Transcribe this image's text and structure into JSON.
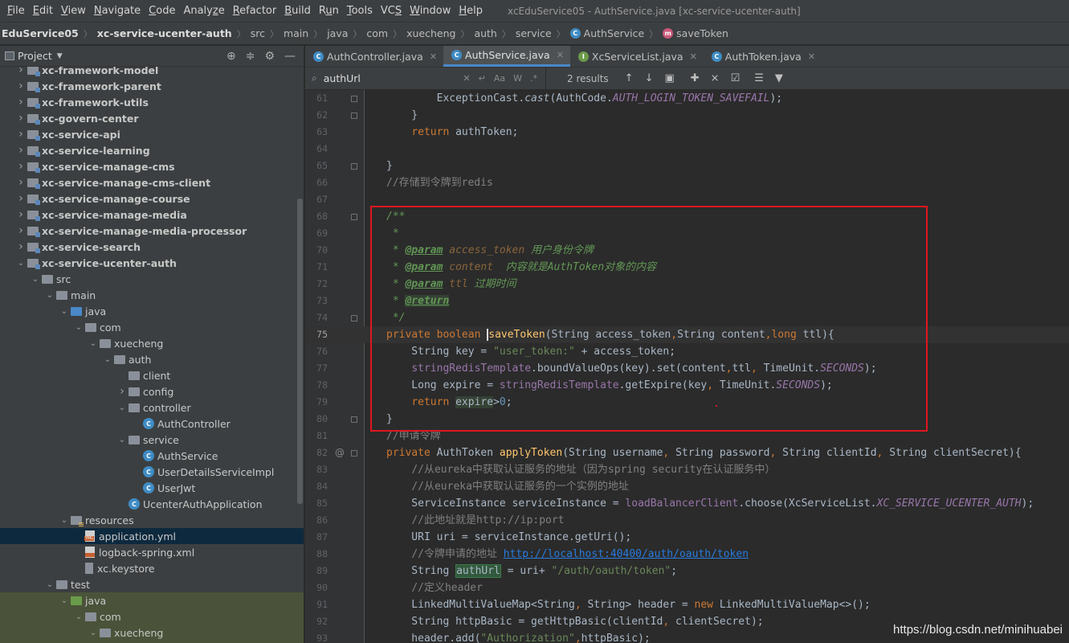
{
  "menu": {
    "items": [
      "File",
      "Edit",
      "View",
      "Navigate",
      "Code",
      "Analyze",
      "Refactor",
      "Build",
      "Run",
      "Tools",
      "VCS",
      "Window",
      "Help"
    ],
    "mnemonics": [
      "F",
      "E",
      "V",
      "N",
      "C",
      "z",
      "R",
      "B",
      "u",
      "T",
      "S",
      "W",
      "H"
    ],
    "window_title": "xcEduService05 - AuthService.java [xc-service-ucenter-auth]"
  },
  "breadcrumb": {
    "project": "EduService05",
    "module": "xc-service-ucenter-auth",
    "parts": [
      "src",
      "main",
      "java",
      "com",
      "xuecheng",
      "auth",
      "service"
    ],
    "class_name": "AuthService",
    "method_name": "saveToken",
    "class_icon_letter": "C",
    "method_icon_letter": "m"
  },
  "project_panel": {
    "title": "Project",
    "tree": [
      {
        "label": "xc-framework-model",
        "depth": 0,
        "arrow": "right",
        "icon": "module"
      },
      {
        "label": "xc-framework-parent",
        "depth": 0,
        "arrow": "right",
        "icon": "module"
      },
      {
        "label": "xc-framework-utils",
        "depth": 0,
        "arrow": "right",
        "icon": "module"
      },
      {
        "label": "xc-govern-center",
        "depth": 0,
        "arrow": "right",
        "icon": "module"
      },
      {
        "label": "xc-service-api",
        "depth": 0,
        "arrow": "right",
        "icon": "module"
      },
      {
        "label": "xc-service-learning",
        "depth": 0,
        "arrow": "right",
        "icon": "module"
      },
      {
        "label": "xc-service-manage-cms",
        "depth": 0,
        "arrow": "right",
        "icon": "module"
      },
      {
        "label": "xc-service-manage-cms-client",
        "depth": 0,
        "arrow": "right",
        "icon": "module"
      },
      {
        "label": "xc-service-manage-course",
        "depth": 0,
        "arrow": "right",
        "icon": "module"
      },
      {
        "label": "xc-service-manage-media",
        "depth": 0,
        "arrow": "right",
        "icon": "module"
      },
      {
        "label": "xc-service-manage-media-processor",
        "depth": 0,
        "arrow": "right",
        "icon": "module"
      },
      {
        "label": "xc-service-search",
        "depth": 0,
        "arrow": "right",
        "icon": "module"
      },
      {
        "label": "xc-service-ucenter-auth",
        "depth": 0,
        "arrow": "down",
        "icon": "module"
      },
      {
        "label": "src",
        "depth": 1,
        "arrow": "down",
        "icon": "folder"
      },
      {
        "label": "main",
        "depth": 2,
        "arrow": "down",
        "icon": "folder"
      },
      {
        "label": "java",
        "depth": 3,
        "arrow": "down",
        "icon": "blue"
      },
      {
        "label": "com",
        "depth": 4,
        "arrow": "down",
        "icon": "folder"
      },
      {
        "label": "xuecheng",
        "depth": 5,
        "arrow": "down",
        "icon": "folder"
      },
      {
        "label": "auth",
        "depth": 6,
        "arrow": "down",
        "icon": "folder"
      },
      {
        "label": "client",
        "depth": 7,
        "arrow": "none",
        "icon": "folder"
      },
      {
        "label": "config",
        "depth": 7,
        "arrow": "right",
        "icon": "folder"
      },
      {
        "label": "controller",
        "depth": 7,
        "arrow": "down",
        "icon": "folder"
      },
      {
        "label": "AuthController",
        "depth": 8,
        "arrow": "none",
        "icon": "class"
      },
      {
        "label": "service",
        "depth": 7,
        "arrow": "down",
        "icon": "folder"
      },
      {
        "label": "AuthService",
        "depth": 8,
        "arrow": "none",
        "icon": "class"
      },
      {
        "label": "UserDetailsServiceImpl",
        "depth": 8,
        "arrow": "none",
        "icon": "class"
      },
      {
        "label": "UserJwt",
        "depth": 8,
        "arrow": "none",
        "icon": "class"
      },
      {
        "label": "UcenterAuthApplication",
        "depth": 7,
        "arrow": "none",
        "icon": "class"
      },
      {
        "label": "resources",
        "depth": 3,
        "arrow": "down",
        "icon": "res"
      },
      {
        "label": "application.yml",
        "depth": 4,
        "arrow": "none",
        "icon": "yml",
        "selected": true
      },
      {
        "label": "logback-spring.xml",
        "depth": 4,
        "arrow": "none",
        "icon": "xml"
      },
      {
        "label": "xc.keystore",
        "depth": 4,
        "arrow": "none",
        "icon": "key"
      },
      {
        "label": "test",
        "depth": 2,
        "arrow": "down",
        "icon": "folder"
      },
      {
        "label": "java",
        "depth": 3,
        "arrow": "down",
        "icon": "green",
        "test": true
      },
      {
        "label": "com",
        "depth": 4,
        "arrow": "down",
        "icon": "folder",
        "test": true
      },
      {
        "label": "xuecheng",
        "depth": 5,
        "arrow": "down",
        "icon": "folder",
        "test": true
      },
      {
        "label": "",
        "depth": 6,
        "arrow": "right",
        "icon": "folder",
        "test": true
      }
    ]
  },
  "tabs": [
    {
      "label": "AuthController.java",
      "active": false,
      "icon": "class"
    },
    {
      "label": "AuthService.java",
      "active": true,
      "icon": "class"
    },
    {
      "label": "XcServiceList.java",
      "active": false,
      "icon": "interface"
    },
    {
      "label": "AuthToken.java",
      "active": false,
      "icon": "class"
    }
  ],
  "search": {
    "value": "authUrl",
    "results": "2 results",
    "option_case": "Aa",
    "option_words": "W",
    "option_regex": ".*"
  },
  "editor": {
    "lines": [
      {
        "n": "61",
        "mark": "",
        "fold": true,
        "cur": false,
        "segs": [
          [
            "        ",
            ""
          ],
          [
            "ExceptionCast.",
            ""
          ],
          [
            "cast",
            "it"
          ],
          [
            "(AuthCode.",
            ""
          ],
          [
            "AUTH_LOGIN_TOKEN_SAVEFAIL",
            "cst"
          ],
          [
            ");",
            ""
          ]
        ]
      },
      {
        "n": "62",
        "mark": "",
        "fold": true,
        "cur": false,
        "segs": [
          [
            "    }",
            ""
          ]
        ]
      },
      {
        "n": "63",
        "mark": "",
        "fold": false,
        "cur": false,
        "segs": [
          [
            "    ",
            ""
          ],
          [
            "return ",
            "kw"
          ],
          [
            "authToken;",
            ""
          ]
        ]
      },
      {
        "n": "64",
        "mark": "",
        "fold": false,
        "cur": false,
        "segs": [
          [
            "",
            ""
          ]
        ]
      },
      {
        "n": "65",
        "mark": "",
        "fold": true,
        "cur": false,
        "segs": [
          [
            "}",
            ""
          ]
        ]
      },
      {
        "n": "66",
        "mark": "",
        "fold": false,
        "cur": false,
        "segs": [
          [
            "//存储到令牌到redis",
            "cmt"
          ]
        ]
      },
      {
        "n": "67",
        "mark": "",
        "fold": false,
        "cur": false,
        "segs": [
          [
            "",
            ""
          ]
        ]
      },
      {
        "n": "68",
        "mark": "",
        "fold": true,
        "cur": false,
        "segs": [
          [
            "/**",
            "doc"
          ]
        ]
      },
      {
        "n": "69",
        "mark": "",
        "fold": false,
        "cur": false,
        "segs": [
          [
            " *",
            "doc"
          ]
        ]
      },
      {
        "n": "70",
        "mark": "",
        "fold": false,
        "cur": false,
        "segs": [
          [
            " * ",
            "doc"
          ],
          [
            "@param",
            "tag"
          ],
          [
            " ",
            "doc"
          ],
          [
            "access_token",
            "dparam"
          ],
          [
            " 用户身份令牌",
            "doc"
          ]
        ]
      },
      {
        "n": "71",
        "mark": "",
        "fold": false,
        "cur": false,
        "segs": [
          [
            " * ",
            "doc"
          ],
          [
            "@param",
            "tag"
          ],
          [
            " ",
            "doc"
          ],
          [
            "content",
            "dparam"
          ],
          [
            "  内容就是AuthToken对象的内容",
            "doc"
          ]
        ]
      },
      {
        "n": "72",
        "mark": "",
        "fold": false,
        "cur": false,
        "segs": [
          [
            " * ",
            "doc"
          ],
          [
            "@param",
            "tag"
          ],
          [
            " ",
            "doc"
          ],
          [
            "ttl",
            "dparam"
          ],
          [
            " 过期时间",
            "doc"
          ]
        ]
      },
      {
        "n": "73",
        "mark": "",
        "fold": false,
        "cur": false,
        "segs": [
          [
            " * ",
            "doc"
          ],
          [
            "@return",
            "tag hl2"
          ]
        ]
      },
      {
        "n": "74",
        "mark": "",
        "fold": true,
        "cur": false,
        "segs": [
          [
            " */",
            "doc"
          ]
        ]
      },
      {
        "n": "75",
        "mark": "",
        "fold": false,
        "cur": true,
        "segs": [
          [
            "private ",
            "kw"
          ],
          [
            "boolean ",
            "kw"
          ],
          [
            "saveToken",
            "fn caret"
          ],
          [
            "(String access_token",
            ""
          ],
          [
            ",",
            "kw"
          ],
          [
            "String content",
            ""
          ],
          [
            ",",
            "kw"
          ],
          [
            "long ",
            "kw"
          ],
          [
            "ttl){",
            ""
          ]
        ]
      },
      {
        "n": "76",
        "mark": "",
        "fold": false,
        "cur": false,
        "segs": [
          [
            "    String key = ",
            ""
          ],
          [
            "\"user_token:\"",
            "str"
          ],
          [
            " + access_token;",
            ""
          ]
        ]
      },
      {
        "n": "77",
        "mark": "",
        "fold": false,
        "cur": false,
        "segs": [
          [
            "    ",
            ""
          ],
          [
            "stringRedisTemplate",
            "fld"
          ],
          [
            ".boundValueOps(key).set(content",
            ""
          ],
          [
            ",",
            "kw"
          ],
          [
            "ttl",
            ""
          ],
          [
            ",",
            "kw"
          ],
          [
            " TimeUnit.",
            ""
          ],
          [
            "SECONDS",
            "cst"
          ],
          [
            ");",
            ""
          ]
        ]
      },
      {
        "n": "78",
        "mark": "",
        "fold": false,
        "cur": false,
        "segs": [
          [
            "    Long expire = ",
            ""
          ],
          [
            "stringRedisTemplate",
            "fld"
          ],
          [
            ".getExpire(key",
            ""
          ],
          [
            ",",
            "kw"
          ],
          [
            " TimeUnit.",
            ""
          ],
          [
            "SECONDS",
            "cst"
          ],
          [
            ");",
            ""
          ]
        ]
      },
      {
        "n": "79",
        "mark": "",
        "fold": false,
        "cur": false,
        "segs": [
          [
            "    ",
            ""
          ],
          [
            "return ",
            "kw"
          ],
          [
            "expire",
            "hl2"
          ],
          [
            ">",
            ""
          ],
          [
            "0",
            "num"
          ],
          [
            ";",
            ""
          ]
        ]
      },
      {
        "n": "80",
        "mark": "",
        "fold": true,
        "cur": false,
        "segs": [
          [
            "}",
            ""
          ]
        ]
      },
      {
        "n": "81",
        "mark": "",
        "fold": false,
        "cur": false,
        "segs": [
          [
            "//申请令牌",
            "cmt"
          ]
        ]
      },
      {
        "n": "82",
        "mark": "@",
        "fold": true,
        "cur": false,
        "segs": [
          [
            "private ",
            "kw"
          ],
          [
            "AuthToken ",
            ""
          ],
          [
            "applyToken",
            "fn"
          ],
          [
            "(String username",
            ""
          ],
          [
            ", ",
            "kw"
          ],
          [
            "String password",
            ""
          ],
          [
            ", ",
            "kw"
          ],
          [
            "String clientId",
            ""
          ],
          [
            ", ",
            "kw"
          ],
          [
            "String clientSecret){",
            ""
          ]
        ]
      },
      {
        "n": "83",
        "mark": "",
        "fold": false,
        "cur": false,
        "segs": [
          [
            "    ",
            ""
          ],
          [
            "//从eureka中获取认证服务的地址（因为spring security在认证服务中）",
            "cmt"
          ]
        ]
      },
      {
        "n": "84",
        "mark": "",
        "fold": false,
        "cur": false,
        "segs": [
          [
            "    ",
            ""
          ],
          [
            "//从eureka中获取认证服务的一个实例的地址",
            "cmt"
          ]
        ]
      },
      {
        "n": "85",
        "mark": "",
        "fold": false,
        "cur": false,
        "segs": [
          [
            "    ServiceInstance serviceInstance = ",
            ""
          ],
          [
            "loadBalancerClient",
            "fld"
          ],
          [
            ".choose(XcServiceList.",
            ""
          ],
          [
            "XC_SERVICE_UCENTER_AUTH",
            "cst"
          ],
          [
            ");",
            ""
          ]
        ]
      },
      {
        "n": "86",
        "mark": "",
        "fold": false,
        "cur": false,
        "segs": [
          [
            "    ",
            ""
          ],
          [
            "//此地址就是http://ip:port",
            "cmt"
          ]
        ]
      },
      {
        "n": "87",
        "mark": "",
        "fold": false,
        "cur": false,
        "segs": [
          [
            "    URI uri = serviceInstance.getUri();",
            ""
          ]
        ]
      },
      {
        "n": "88",
        "mark": "",
        "fold": false,
        "cur": false,
        "segs": [
          [
            "    ",
            ""
          ],
          [
            "//令牌申请的地址 ",
            "cmt"
          ],
          [
            "http://localhost:40400/auth/oauth/token",
            "link"
          ]
        ]
      },
      {
        "n": "89",
        "mark": "",
        "fold": false,
        "cur": false,
        "segs": [
          [
            "    String ",
            ""
          ],
          [
            "authUrl",
            "hl"
          ],
          [
            " = uri+ ",
            ""
          ],
          [
            "\"/auth/oauth/token\"",
            "str"
          ],
          [
            ";",
            ""
          ]
        ]
      },
      {
        "n": "90",
        "mark": "",
        "fold": false,
        "cur": false,
        "segs": [
          [
            "    ",
            ""
          ],
          [
            "//定义header",
            "cmt"
          ]
        ]
      },
      {
        "n": "91",
        "mark": "",
        "fold": false,
        "cur": false,
        "segs": [
          [
            "    LinkedMultiValueMap<String",
            ""
          ],
          [
            ", ",
            "kw"
          ],
          [
            "String> header = ",
            ""
          ],
          [
            "new ",
            "kw"
          ],
          [
            "LinkedMultiValueMap<>();",
            ""
          ]
        ]
      },
      {
        "n": "92",
        "mark": "",
        "fold": false,
        "cur": false,
        "segs": [
          [
            "    String httpBasic = getHttpBasic(clientId",
            ""
          ],
          [
            ", ",
            "kw"
          ],
          [
            "clientSecret);",
            ""
          ]
        ]
      },
      {
        "n": "93",
        "mark": "",
        "fold": false,
        "cur": false,
        "segs": [
          [
            "    header.add(",
            ""
          ],
          [
            "\"Authorization\"",
            "str"
          ],
          [
            ",",
            "kw"
          ],
          [
            "httpBasic);",
            ""
          ]
        ]
      }
    ]
  },
  "watermark": "https://blog.csdn.net/minihuabei"
}
